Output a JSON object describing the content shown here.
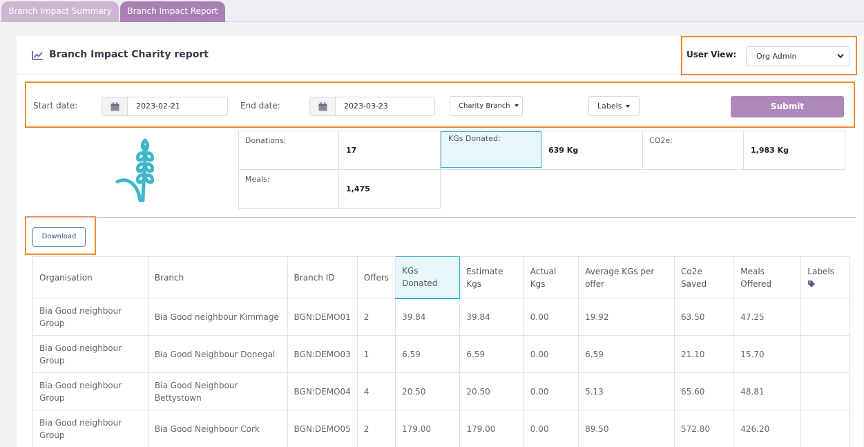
{
  "tabs": [
    {
      "label": "Branch Impact Summary"
    },
    {
      "label": "Branch Impact Report"
    }
  ],
  "header": {
    "title": "Branch Impact Charity report",
    "user_view_label": "User View:",
    "user_view_value": "Org Admin"
  },
  "filters": {
    "start_label": "Start date:",
    "start_value": "2023-02-21",
    "end_label": "End date:",
    "end_value": "2023-03-23",
    "branch_dropdown": "Charity Branch",
    "labels_dropdown": "Labels",
    "submit_label": "Submit"
  },
  "stats": {
    "donations_label": "Donations:",
    "donations_value": "17",
    "kgs_label": "KGs Donated:",
    "kgs_value": "639 Kg",
    "co2_label": "CO2e:",
    "co2_value": "1,983 Kg",
    "meals_label": "Meals:",
    "meals_value": "1,475"
  },
  "download_label": "Download",
  "table": {
    "headers": [
      "Organisation",
      "Branch",
      "Branch ID",
      "Offers",
      "KGs Donated",
      "Estimate Kgs",
      "Actual Kgs",
      "Average KGs per offer",
      "Co2e Saved",
      "Meals Offered",
      "Labels"
    ],
    "rows": [
      [
        "Bia Good neighbour Group",
        "Bia Good neighbour Kimmage",
        "BGN:DEMO01",
        "2",
        "39.84",
        "39.84",
        "0.00",
        "19.92",
        "63.50",
        "47.25",
        ""
      ],
      [
        "Bia Good neighbour Group",
        "Bia Good Neighbour Donegal",
        "BGN:DEMO03",
        "1",
        "6.59",
        "6.59",
        "0.00",
        "6.59",
        "21.10",
        "15.70",
        ""
      ],
      [
        "Bia Good neighbour Group",
        "Bia Good Neighbour Bettystown",
        "BGN:DEMO04",
        "4",
        "20.50",
        "20.50",
        "0.00",
        "5.13",
        "65.60",
        "48.81",
        ""
      ],
      [
        "Bia Good neighbour Group",
        "Bia Good Neighbour Cork",
        "BGN:DEMO05",
        "2",
        "179.00",
        "179.00",
        "0.00",
        "89.50",
        "572.80",
        "426.20",
        ""
      ]
    ]
  },
  "colors": {
    "accent": "#ae88b8",
    "highlight_outline": "#ef8a30",
    "wheat_icon": "#3fb7c9",
    "active_cell": "#e8f7fc"
  },
  "icons": {
    "title_icon": "line-chart-icon",
    "calendar": "calendar-icon",
    "wheat": "wheat-icon",
    "labels_header": "tag-icon"
  }
}
